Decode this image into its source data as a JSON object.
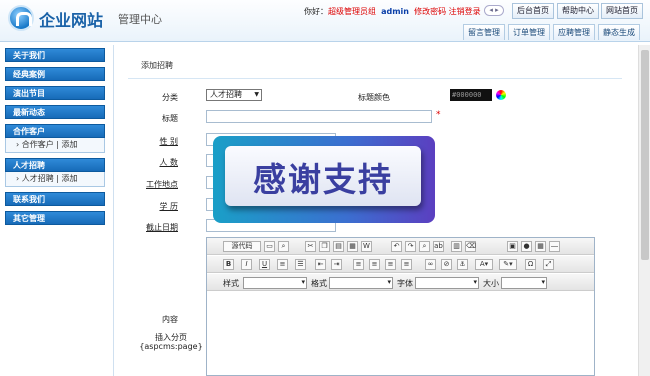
{
  "header": {
    "brand": "企业网站",
    "subtitle": "管理中心",
    "greeting": "你好：",
    "role": "超级管理员组",
    "user": "admin",
    "links": "修改密码 注销登录",
    "buttons": [
      "后台首页",
      "帮助中心",
      "网站首页"
    ],
    "tabs": [
      "留言管理",
      "订单管理",
      "应聘管理",
      "静态生成"
    ]
  },
  "sidebar": [
    {
      "label": "关于我们"
    },
    {
      "label": "经典案例"
    },
    {
      "label": "演出节目"
    },
    {
      "label": "最新动态"
    },
    {
      "label": "合作客户",
      "sub": "› 合作客户 | 添加"
    },
    {
      "label": "人才招聘",
      "sub": "› 人才招聘 | 添加"
    },
    {
      "label": "联系我们"
    },
    {
      "label": "其它管理"
    }
  ],
  "page": {
    "title": "添加招聘"
  },
  "form": {
    "category_label": "分类",
    "category_value": "人才招聘",
    "title_color_label": "标题颜色",
    "title_color_value": "#000000",
    "title_label": "标题",
    "required_mark": "*",
    "gender_label": "性 别",
    "count_label": "人 数",
    "location_label": "工作地点",
    "education_label": "学 历",
    "deadline_label": "截止日期",
    "content_label": "内容",
    "page_label": "插入分页",
    "page_code": "{aspcms:page}"
  },
  "overlay": {
    "text": "感谢支持"
  },
  "editor": {
    "source_label": "源代码",
    "style_label": "样式",
    "format_label": "格式",
    "font_label": "字体",
    "size_label": "大小",
    "bold": "B",
    "italic": "I",
    "underline": "U",
    "special": "Ω"
  }
}
